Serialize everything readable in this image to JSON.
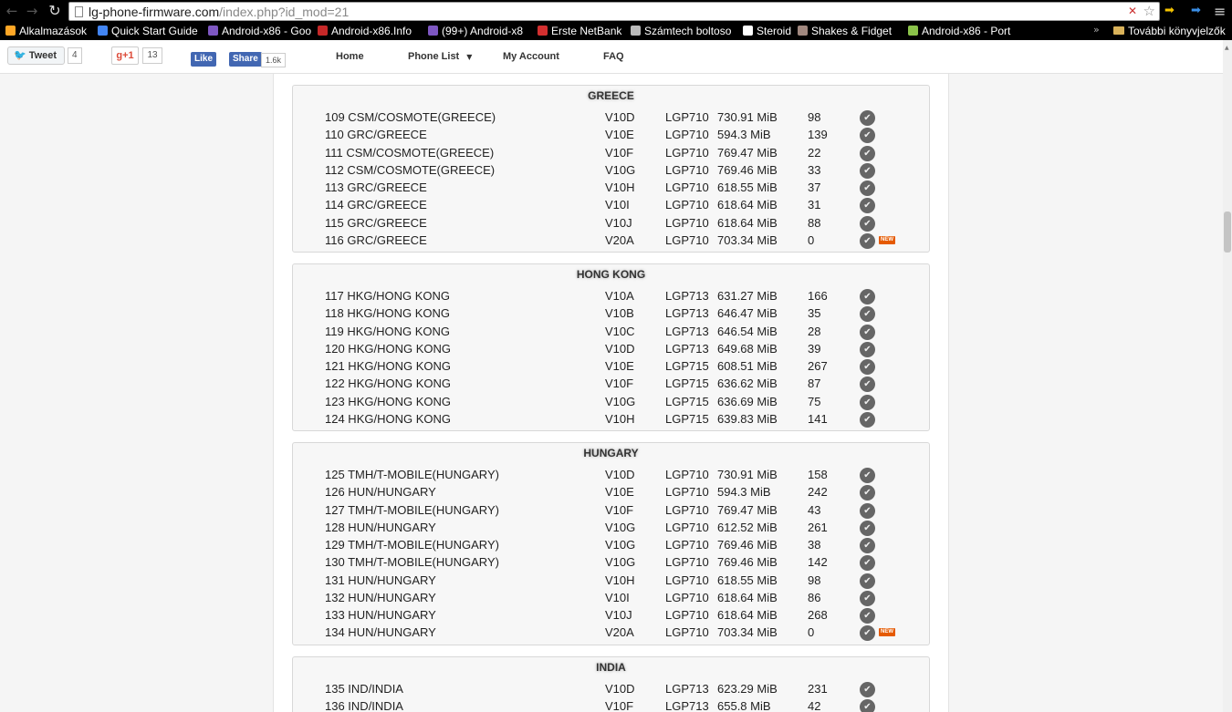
{
  "browser": {
    "url_host": "lg-phone-firmware.com",
    "url_path": "/index.php?id_mod=21",
    "bookmarks": [
      {
        "label": "Alkalmazások",
        "color": "#ffa726",
        "icon": "apps-grid-icon"
      },
      {
        "label": "Quick Start Guide",
        "color": "#4285f4",
        "icon": "google-icon"
      },
      {
        "label": "Android-x86 - Goo",
        "color": "#7e57c2",
        "icon": "forum-icon"
      },
      {
        "label": "Android-x86.Info",
        "color": "#c62828",
        "icon": "site-icon"
      },
      {
        "label": "(99+) Android-x8",
        "color": "#7e57c2",
        "icon": "forum-icon"
      },
      {
        "label": "Erste NetBank",
        "color": "#d32f2f",
        "icon": "bank-icon"
      },
      {
        "label": "Számtech boltoso",
        "color": "#bbbbbb",
        "icon": "circle-icon"
      },
      {
        "label": "Steroid",
        "color": "#ffffff",
        "icon": "page-icon"
      },
      {
        "label": "Shakes & Fidget",
        "color": "#a1887f",
        "icon": "game-icon"
      },
      {
        "label": "Android-x86 - Port",
        "color": "#8bc34a",
        "icon": "android-icon"
      }
    ],
    "more_bookmarks": "»",
    "other_bookmarks": "További könyvjelzők"
  },
  "header": {
    "tweet_label": "Tweet",
    "tweet_count": "4",
    "gplus_label": "g+1",
    "gplus_count": "13",
    "fb_like": "Like",
    "fb_share": "Share",
    "fb_count": "1.6k",
    "nav": {
      "home": "Home",
      "phone_list": "Phone List",
      "account": "My Account",
      "faq": "FAQ"
    }
  },
  "regions": [
    {
      "name": "GREECE",
      "rows": [
        {
          "name": "109 CSM/COSMOTE(GREECE)",
          "version": "V10D",
          "model": "LGP710",
          "size": "730.91 MiB",
          "downloads": "98",
          "new": false
        },
        {
          "name": "110 GRC/GREECE",
          "version": "V10E",
          "model": "LGP710",
          "size": "594.3 MiB",
          "downloads": "139",
          "new": false
        },
        {
          "name": "111 CSM/COSMOTE(GREECE)",
          "version": "V10F",
          "model": "LGP710",
          "size": "769.47 MiB",
          "downloads": "22",
          "new": false
        },
        {
          "name": "112 CSM/COSMOTE(GREECE)",
          "version": "V10G",
          "model": "LGP710",
          "size": "769.46 MiB",
          "downloads": "33",
          "new": false
        },
        {
          "name": "113 GRC/GREECE",
          "version": "V10H",
          "model": "LGP710",
          "size": "618.55 MiB",
          "downloads": "37",
          "new": false
        },
        {
          "name": "114 GRC/GREECE",
          "version": "V10I",
          "model": "LGP710",
          "size": "618.64 MiB",
          "downloads": "31",
          "new": false
        },
        {
          "name": "115 GRC/GREECE",
          "version": "V10J",
          "model": "LGP710",
          "size": "618.64 MiB",
          "downloads": "88",
          "new": false
        },
        {
          "name": "116 GRC/GREECE",
          "version": "V20A",
          "model": "LGP710",
          "size": "703.34 MiB",
          "downloads": "0",
          "new": true
        }
      ]
    },
    {
      "name": "HONG KONG",
      "rows": [
        {
          "name": "117 HKG/HONG KONG",
          "version": "V10A",
          "model": "LGP713",
          "size": "631.27 MiB",
          "downloads": "166",
          "new": false
        },
        {
          "name": "118 HKG/HONG KONG",
          "version": "V10B",
          "model": "LGP713",
          "size": "646.47 MiB",
          "downloads": "35",
          "new": false
        },
        {
          "name": "119 HKG/HONG KONG",
          "version": "V10C",
          "model": "LGP713",
          "size": "646.54 MiB",
          "downloads": "28",
          "new": false
        },
        {
          "name": "120 HKG/HONG KONG",
          "version": "V10D",
          "model": "LGP713",
          "size": "649.68 MiB",
          "downloads": "39",
          "new": false
        },
        {
          "name": "121 HKG/HONG KONG",
          "version": "V10E",
          "model": "LGP715",
          "size": "608.51 MiB",
          "downloads": "267",
          "new": false
        },
        {
          "name": "122 HKG/HONG KONG",
          "version": "V10F",
          "model": "LGP715",
          "size": "636.62 MiB",
          "downloads": "87",
          "new": false
        },
        {
          "name": "123 HKG/HONG KONG",
          "version": "V10G",
          "model": "LGP715",
          "size": "636.69 MiB",
          "downloads": "75",
          "new": false
        },
        {
          "name": "124 HKG/HONG KONG",
          "version": "V10H",
          "model": "LGP715",
          "size": "639.83 MiB",
          "downloads": "141",
          "new": false
        }
      ]
    },
    {
      "name": "HUNGARY",
      "rows": [
        {
          "name": "125 TMH/T-MOBILE(HUNGARY)",
          "version": "V10D",
          "model": "LGP710",
          "size": "730.91 MiB",
          "downloads": "158",
          "new": false
        },
        {
          "name": "126 HUN/HUNGARY",
          "version": "V10E",
          "model": "LGP710",
          "size": "594.3 MiB",
          "downloads": "242",
          "new": false
        },
        {
          "name": "127 TMH/T-MOBILE(HUNGARY)",
          "version": "V10F",
          "model": "LGP710",
          "size": "769.47 MiB",
          "downloads": "43",
          "new": false
        },
        {
          "name": "128 HUN/HUNGARY",
          "version": "V10G",
          "model": "LGP710",
          "size": "612.52 MiB",
          "downloads": "261",
          "new": false
        },
        {
          "name": "129 TMH/T-MOBILE(HUNGARY)",
          "version": "V10G",
          "model": "LGP710",
          "size": "769.46 MiB",
          "downloads": "38",
          "new": false
        },
        {
          "name": "130 TMH/T-MOBILE(HUNGARY)",
          "version": "V10G",
          "model": "LGP710",
          "size": "769.46 MiB",
          "downloads": "142",
          "new": false
        },
        {
          "name": "131 HUN/HUNGARY",
          "version": "V10H",
          "model": "LGP710",
          "size": "618.55 MiB",
          "downloads": "98",
          "new": false
        },
        {
          "name": "132 HUN/HUNGARY",
          "version": "V10I",
          "model": "LGP710",
          "size": "618.64 MiB",
          "downloads": "86",
          "new": false
        },
        {
          "name": "133 HUN/HUNGARY",
          "version": "V10J",
          "model": "LGP710",
          "size": "618.64 MiB",
          "downloads": "268",
          "new": false
        },
        {
          "name": "134 HUN/HUNGARY",
          "version": "V20A",
          "model": "LGP710",
          "size": "703.34 MiB",
          "downloads": "0",
          "new": true
        }
      ]
    },
    {
      "name": "INDIA",
      "rows": [
        {
          "name": "135 IND/INDIA",
          "version": "V10D",
          "model": "LGP713",
          "size": "623.29 MiB",
          "downloads": "231",
          "new": false
        },
        {
          "name": "136 IND/INDIA",
          "version": "V10F",
          "model": "LGP713",
          "size": "655.8 MiB",
          "downloads": "42",
          "new": false
        }
      ]
    }
  ],
  "new_badge": "NEW"
}
